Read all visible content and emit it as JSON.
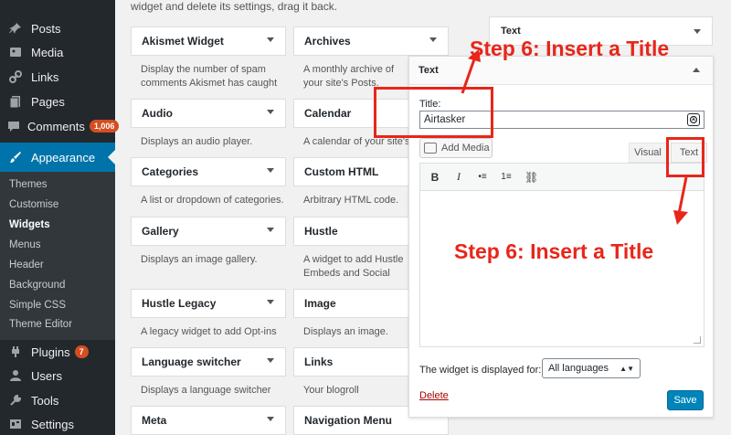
{
  "sidebar": {
    "items": [
      {
        "label": "Posts",
        "icon": "pin-icon"
      },
      {
        "label": "Media",
        "icon": "media-icon"
      },
      {
        "label": "Links",
        "icon": "link-icon"
      },
      {
        "label": "Pages",
        "icon": "pages-icon"
      },
      {
        "label": "Comments",
        "icon": "comment-icon",
        "badge": "1,006"
      },
      {
        "label": "Appearance",
        "icon": "brush-icon"
      },
      {
        "label": "Plugins",
        "icon": "plugin-icon",
        "badge": "7"
      },
      {
        "label": "Users",
        "icon": "user-icon"
      },
      {
        "label": "Tools",
        "icon": "wrench-icon"
      },
      {
        "label": "Settings",
        "icon": "settings-icon"
      }
    ],
    "submenu": [
      "Themes",
      "Customise",
      "Widgets",
      "Menus",
      "Header",
      "Background",
      "Simple CSS",
      "Theme Editor"
    ]
  },
  "intro_text": "widget and delete its settings, drag it back.",
  "widgets": [
    {
      "title": "Akismet Widget",
      "desc": "Display the number of spam comments Akismet has caught"
    },
    {
      "title": "Archives",
      "desc": "A monthly archive of your site's Posts."
    },
    {
      "title": "Audio",
      "desc": "Displays an audio player."
    },
    {
      "title": "Calendar",
      "desc": "A calendar of your site's Posts."
    },
    {
      "title": "Categories",
      "desc": "A list or dropdown of categories."
    },
    {
      "title": "Custom HTML",
      "desc": "Arbitrary HTML code."
    },
    {
      "title": "Gallery",
      "desc": "Displays an image gallery."
    },
    {
      "title": "Hustle",
      "desc": "A widget to add Hustle Embeds and Social Sharing."
    },
    {
      "title": "Hustle Legacy",
      "desc": "A legacy widget to add Opt-ins"
    },
    {
      "title": "Image",
      "desc": "Displays an image."
    },
    {
      "title": "Language switcher",
      "desc": "Displays a language switcher"
    },
    {
      "title": "Links",
      "desc": "Your blogroll"
    },
    {
      "title": "Meta",
      "desc": ""
    },
    {
      "title": "Navigation Menu",
      "desc": ""
    }
  ],
  "sidebar_widget_title": "Text",
  "editor": {
    "header": "Text",
    "title_label": "Title:",
    "title_value": "Airtasker",
    "add_media": "Add Media",
    "tab_visual": "Visual",
    "tab_text": "Text",
    "toolbar": [
      "B",
      "I",
      "•≡",
      "1≡",
      "⛓"
    ],
    "display_label": "The widget is displayed for:",
    "language_value": "All languages",
    "delete_label": "Delete",
    "save_label": "Save"
  },
  "annotations": {
    "step_top": "Step 6: Insert a Title",
    "step_right": "Step 6: Insert a Title"
  },
  "colors": {
    "accent": "#0073aa",
    "annotation": "#e8261a",
    "save": "#0085ba"
  }
}
